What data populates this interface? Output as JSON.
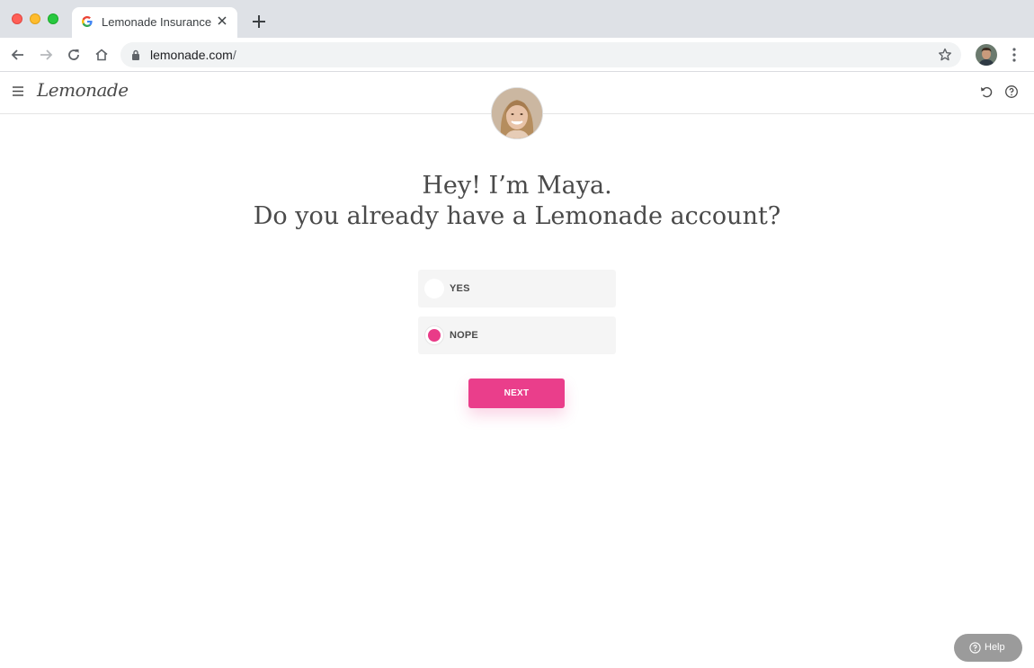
{
  "browser": {
    "tab_title": "Lemonade Insurance",
    "url_host": "lemonade.com",
    "url_path": "/"
  },
  "app": {
    "logo": "Lemonade",
    "headline_line1": "Hey! I’m Maya.",
    "headline_line2": "Do you already have a Lemonade account?",
    "options": [
      {
        "label": "YES",
        "selected": false
      },
      {
        "label": "NOPE",
        "selected": true
      }
    ],
    "next_label": "NEXT",
    "help_label": "Help"
  },
  "colors": {
    "accent": "#ea3e8b",
    "help_bg": "#9b9b9b"
  }
}
